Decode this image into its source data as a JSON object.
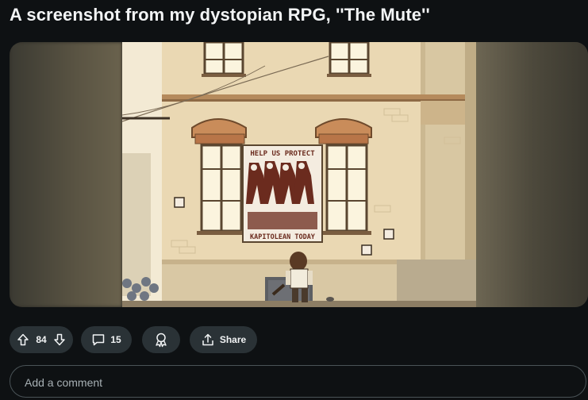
{
  "post": {
    "title": "A screenshot from my dystopian RPG, ''The Mute''"
  },
  "game_scene": {
    "banner_top_text": "HELP US PROTECT",
    "banner_bottom_text": "KAPITOLEAN TODAY"
  },
  "actions": {
    "vote_count": "84",
    "comment_count": "15",
    "share_label": "Share"
  },
  "comment_input": {
    "placeholder": "Add a comment"
  },
  "colors": {
    "background": "#0e1113",
    "pill": "#2a3236",
    "text": "#f2f4f5",
    "wall": "#e9d8b4",
    "banner_red": "#6b2b1e"
  },
  "icons": [
    "upvote-icon",
    "downvote-icon",
    "comment-icon",
    "award-icon",
    "share-icon"
  ]
}
